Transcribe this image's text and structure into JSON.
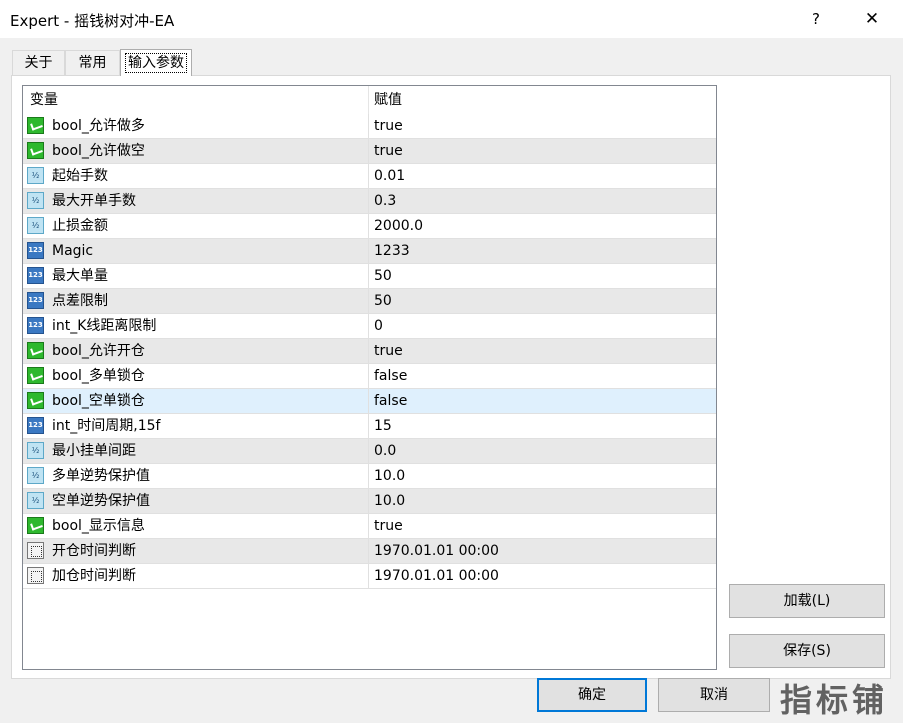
{
  "window": {
    "title": "Expert - 摇钱树对冲-EA",
    "help_label": "?",
    "close_label": "✕"
  },
  "tabs": [
    {
      "label": "关于"
    },
    {
      "label": "常用"
    },
    {
      "label": "输入参数"
    }
  ],
  "grid": {
    "header_variable": "变量",
    "header_value": "赋值",
    "rows": [
      {
        "icon": "bool-icon",
        "name": "bool_允许做多",
        "value": "true"
      },
      {
        "icon": "bool-icon",
        "name": "bool_允许做空",
        "value": "true"
      },
      {
        "icon": "double-icon",
        "name": "起始手数",
        "value": "0.01"
      },
      {
        "icon": "double-icon",
        "name": "最大开单手数",
        "value": "0.3"
      },
      {
        "icon": "double-icon",
        "name": "止损金额",
        "value": "2000.0"
      },
      {
        "icon": "int-icon",
        "name": "Magic",
        "value": "1233"
      },
      {
        "icon": "int-icon",
        "name": "最大单量",
        "value": "50"
      },
      {
        "icon": "int-icon",
        "name": "点差限制",
        "value": "50"
      },
      {
        "icon": "int-icon",
        "name": "int_K线距离限制",
        "value": "0"
      },
      {
        "icon": "bool-icon",
        "name": "bool_允许开仓",
        "value": "true"
      },
      {
        "icon": "bool-icon",
        "name": "bool_多单锁仓",
        "value": "false"
      },
      {
        "icon": "bool-icon",
        "name": "bool_空单锁仓",
        "value": "false"
      },
      {
        "icon": "int-icon",
        "name": "int_时间周期,15f",
        "value": "15"
      },
      {
        "icon": "double-icon",
        "name": "最小挂单间距",
        "value": "0.0"
      },
      {
        "icon": "double-icon",
        "name": "多单逆势保护值",
        "value": "10.0"
      },
      {
        "icon": "double-icon",
        "name": "空单逆势保护值",
        "value": "10.0"
      },
      {
        "icon": "bool-icon",
        "name": "bool_显示信息",
        "value": "true"
      },
      {
        "icon": "datetime-icon",
        "name": "开仓时间判断",
        "value": "1970.01.01 00:00"
      },
      {
        "icon": "datetime-icon",
        "name": "加仓时间判断",
        "value": "1970.01.01 00:00"
      }
    ]
  },
  "icon_glyphs": {
    "double": "½",
    "int": "123"
  },
  "buttons": {
    "load": "加载(L)",
    "save": "保存(S)",
    "ok": "确定",
    "cancel": "取消"
  },
  "watermark": "指标铺"
}
